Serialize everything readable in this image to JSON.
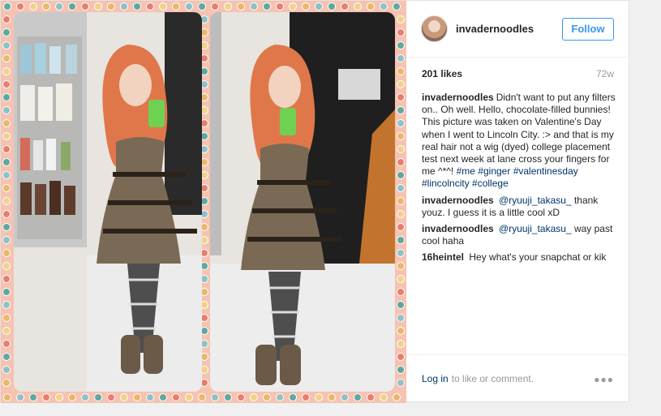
{
  "header": {
    "username": "invadernoodles",
    "follow_label": "Follow"
  },
  "stats": {
    "likes": "201 likes",
    "time": "72w"
  },
  "caption": {
    "author": "invadernoodles",
    "text": "Didn't want to put any filters on.. Oh well. Hello, chocolate-filled bunnies! This picture was taken on Valentine's Day when I went to Lincoln City. :> and that is my real hair not a wig (dyed) college placement test next week at lane cross your fingers for me ^*^!",
    "tags": [
      "#me",
      "#ginger",
      "#valentinesday",
      "#lincolncity",
      "#college"
    ]
  },
  "comments": [
    {
      "author": "invadernoodles",
      "mention": "@ryuuji_takasu_",
      "text": "thank youz. I guess it is a little cool xD"
    },
    {
      "author": "invadernoodles",
      "mention": "@ryuuji_takasu_",
      "text": "way past cool haha"
    },
    {
      "author": "16heintel",
      "mention": "",
      "text": "Hey what's your snapchat or kik"
    }
  ],
  "footer": {
    "login_label": "Log in",
    "rest": "to like or comment.",
    "more_icon": "more-options-icon"
  }
}
